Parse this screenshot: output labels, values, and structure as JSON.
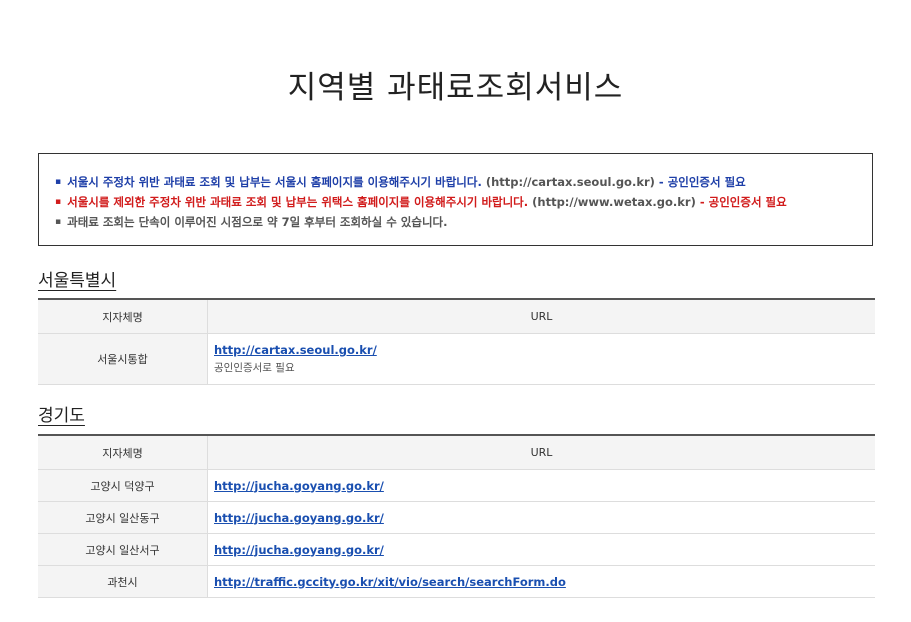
{
  "page_title": "지역별 과태료조회서비스",
  "notices": [
    {
      "bullet": "▪",
      "text": "서울시 주정차 위반 과태료 조회 및 납부는 서울시 홈페이지를 이용해주시기 바랍니다.",
      "url": "(http://cartax.seoul.go.kr)",
      "sep": " - ",
      "tail": "공인인증서 필요",
      "color": "#1e3fa8"
    },
    {
      "bullet": "▪",
      "text": "서울시를 제외한 주정차 위반 과태료 조회 및 납부는 위택스 홈페이지를 이용해주시기 바랍니다.",
      "url": "(http://www.wetax.go.kr)",
      "sep": " - ",
      "tail": "공인인증서 필요",
      "color": "#d11b1b"
    },
    {
      "bullet": "▪",
      "text": "과태료 조회는 단속이 이루어진 시점으로 약 7일 후부터 조회하실 수 있습니다.",
      "color": "#555555"
    }
  ],
  "sections": [
    {
      "title": "서울특별시",
      "headers": {
        "name": "지자체명",
        "url": "URL"
      },
      "rows": [
        {
          "name": "서울시통합",
          "url": "http://cartax.seoul.go.kr/",
          "note": "공인인증서로 필요"
        }
      ]
    },
    {
      "title": "경기도",
      "headers": {
        "name": "지자체명",
        "url": "URL"
      },
      "rows": [
        {
          "name": "고양시 덕양구",
          "url": "http://jucha.goyang.go.kr/"
        },
        {
          "name": "고양시 일산동구",
          "url": "http://jucha.goyang.go.kr/"
        },
        {
          "name": "고양시 일산서구",
          "url": "http://jucha.goyang.go.kr/"
        },
        {
          "name": "과천시",
          "url": "http://traffic.gccity.go.kr/xit/vio/search/searchForm.do"
        }
      ]
    }
  ],
  "colors": {
    "link": "#1a4fb0",
    "notice_blue": "#1e3fa8",
    "notice_red": "#d11b1b"
  }
}
